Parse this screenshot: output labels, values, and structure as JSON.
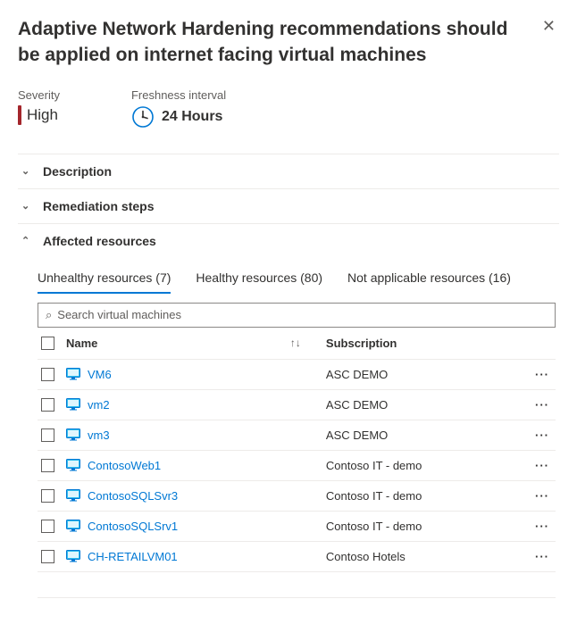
{
  "header": {
    "title": "Adaptive Network Hardening recommendations should be applied on internet facing virtual machines"
  },
  "meta": {
    "severity_label": "Severity",
    "severity_value": "High",
    "freshness_label": "Freshness interval",
    "freshness_value": "24 Hours"
  },
  "sections": {
    "description": "Description",
    "remediation": "Remediation steps",
    "affected": "Affected resources"
  },
  "tabs": {
    "unhealthy": "Unhealthy resources (7)",
    "healthy": "Healthy resources (80)",
    "na": "Not applicable resources (16)"
  },
  "search": {
    "placeholder": "Search virtual machines"
  },
  "columns": {
    "name": "Name",
    "subscription": "Subscription"
  },
  "rows": [
    {
      "name": "VM6",
      "subscription": "ASC DEMO"
    },
    {
      "name": "vm2",
      "subscription": "ASC DEMO"
    },
    {
      "name": "vm3",
      "subscription": "ASC DEMO"
    },
    {
      "name": "ContosoWeb1",
      "subscription": "Contoso IT - demo"
    },
    {
      "name": "ContosoSQLSvr3",
      "subscription": "Contoso IT - demo"
    },
    {
      "name": "ContosoSQLSrv1",
      "subscription": "Contoso IT - demo"
    },
    {
      "name": "CH-RETAILVM01",
      "subscription": "Contoso Hotels"
    }
  ]
}
